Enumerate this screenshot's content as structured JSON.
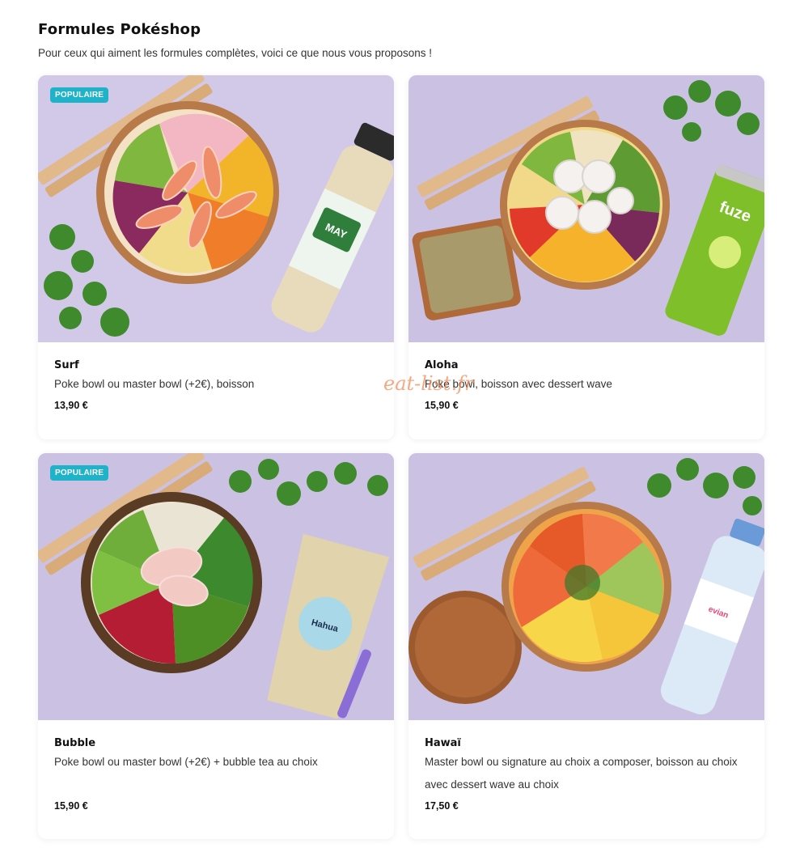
{
  "page": {
    "title": "Formules Pokéshop",
    "subtitle": "Pour ceux qui aiment les formules complètes, voici ce que nous vous proposons !"
  },
  "colors": {
    "badge": "#1fb3c9",
    "background": "#ffffff",
    "image_backdrop": "#cfc6e6",
    "watermark": "#f08c5a"
  },
  "watermark": "eat-list.fr",
  "formulas": [
    {
      "name": "Surf",
      "badge": "POPULAIRE",
      "description": "Poke bowl ou master bowl (+2€), boisson",
      "price": "13,90 €",
      "image_icon": "poke-bowl-with-tea-bottle"
    },
    {
      "name": "Aloha",
      "badge": "",
      "description": "Poke bowl, boisson avec dessert wave",
      "price": "15,90 €",
      "image_icon": "poke-bowl-with-cake-and-can"
    },
    {
      "name": "Bubble",
      "badge": "POPULAIRE",
      "description": "Poke bowl ou master bowl (+2€) + bubble tea au choix",
      "price": "15,90 €",
      "image_icon": "poke-bowl-with-bubble-tea"
    },
    {
      "name": "Hawaï",
      "badge": "",
      "description": "Master bowl ou signature au choix a composer, boisson au choix avec dessert wave au choix",
      "price": "17,50 €",
      "image_icon": "poke-bowl-with-cookie-and-water"
    }
  ]
}
